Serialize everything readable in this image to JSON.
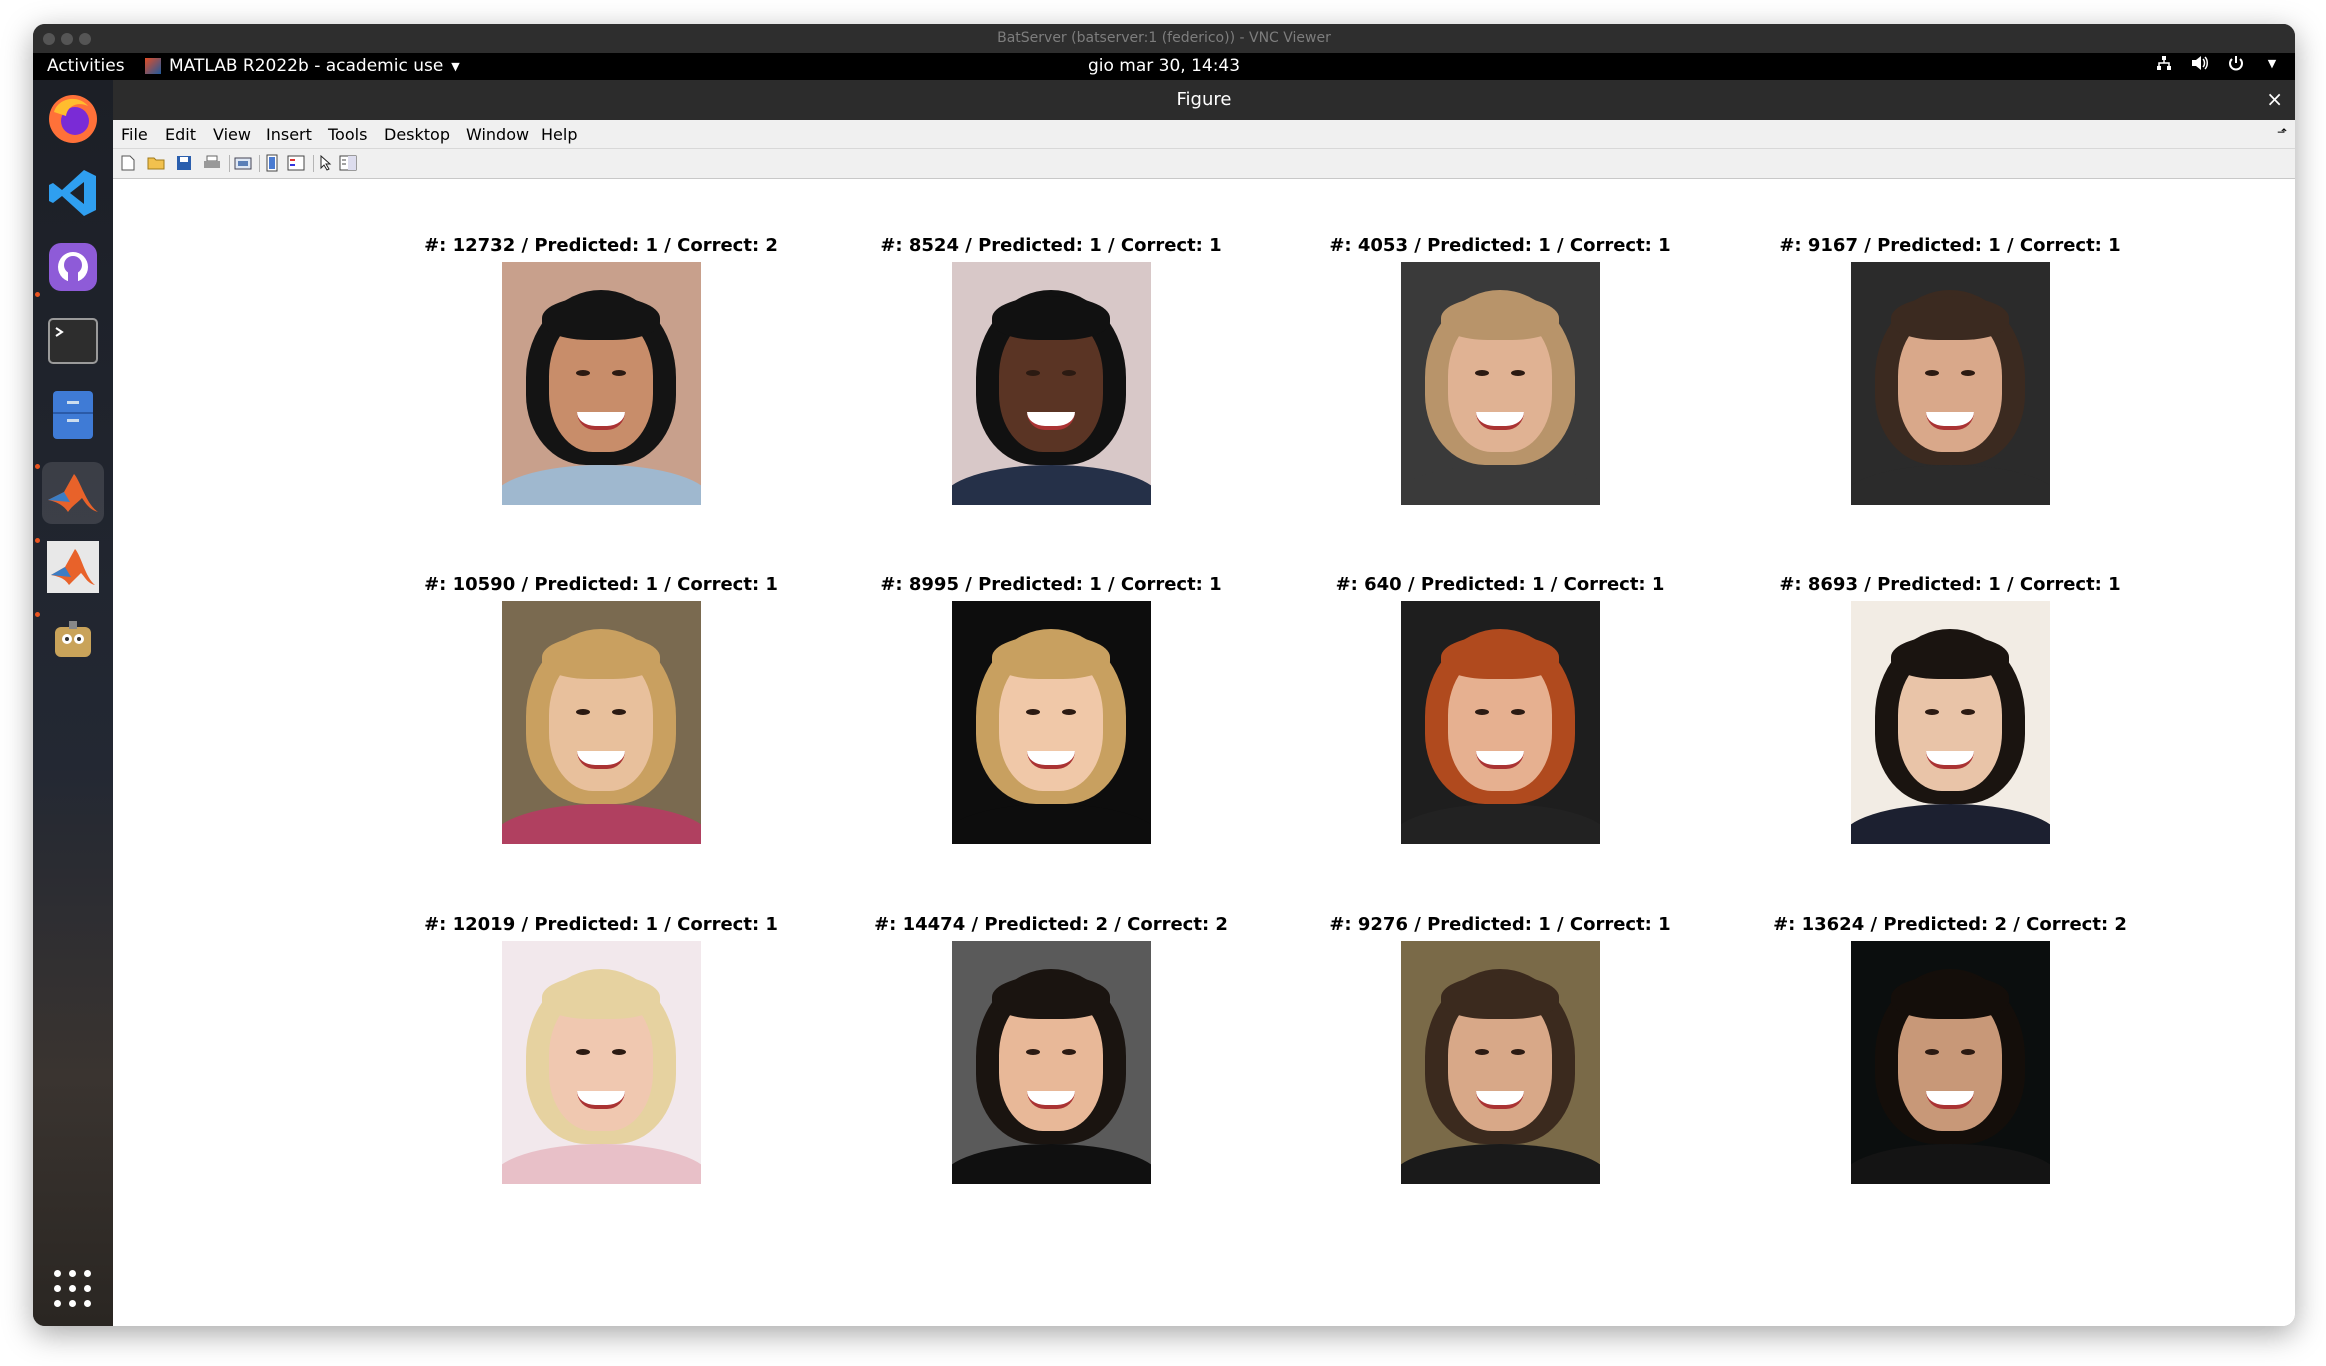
{
  "vnc": {
    "title": "BatServer (batserver:1 (federico)) - VNC Viewer"
  },
  "topbar": {
    "activities": "Activities",
    "app_menu": "MATLAB R2022b - academic use",
    "clock": "gio mar 30, 14:43"
  },
  "dock": {
    "items": [
      "firefox-icon",
      "vscode-icon",
      "github-desktop-icon",
      "terminal-icon",
      "files-icon",
      "matlab-icon",
      "matlab-icon-2",
      "gimp-icon"
    ],
    "show_apps_icon": "app-grid-icon"
  },
  "figure": {
    "title": "Figure",
    "close": "×",
    "menus": [
      {
        "label": "File"
      },
      {
        "label": "Edit"
      },
      {
        "label": "View"
      },
      {
        "label": "Insert"
      },
      {
        "label": "Tools"
      },
      {
        "label": "Desktop"
      },
      {
        "label": "Window"
      },
      {
        "label": "Help"
      }
    ],
    "toolbar": [
      "new-figure-icon",
      "open-icon",
      "save-icon",
      "print-icon",
      "link-plot-icon",
      "colorbar-icon",
      "legend-icon",
      "pointer-icon",
      "property-editor-icon"
    ],
    "subplots": [
      {
        "title": "#: 12732 / Predicted: 1 / Correct: 2"
      },
      {
        "title": "#: 8524 / Predicted: 1 / Correct: 1"
      },
      {
        "title": "#: 4053 / Predicted: 1 / Correct: 1"
      },
      {
        "title": "#: 9167 / Predicted: 1 / Correct: 1"
      },
      {
        "title": "#: 10590 / Predicted: 1 / Correct: 1"
      },
      {
        "title": "#: 8995 / Predicted: 1 / Correct: 1"
      },
      {
        "title": "#: 640 / Predicted: 1 / Correct: 1"
      },
      {
        "title": "#: 8693 / Predicted: 1 / Correct: 1"
      },
      {
        "title": "#: 12019 / Predicted: 1 / Correct: 1"
      },
      {
        "title": "#: 14474 / Predicted: 2 / Correct: 2"
      },
      {
        "title": "#: 9276 / Predicted: 1 / Correct: 1"
      },
      {
        "title": "#: 13624 / Predicted: 2 / Correct: 2"
      }
    ]
  }
}
